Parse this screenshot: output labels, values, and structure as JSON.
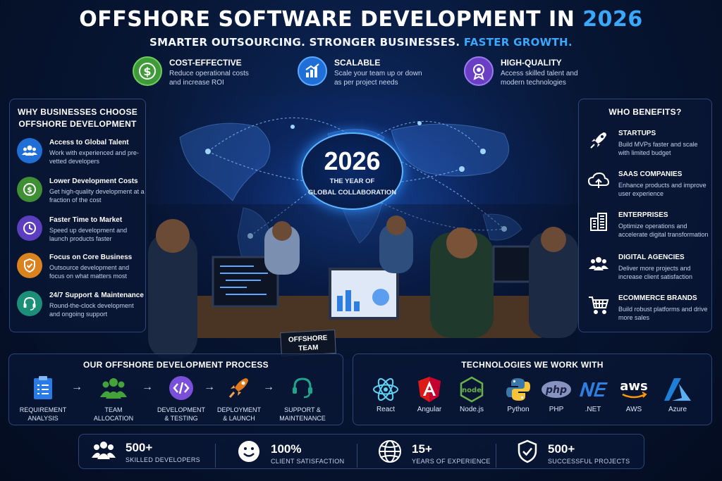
{
  "header": {
    "title_main": "OFFSHORE SOFTWARE DEVELOPMENT IN ",
    "title_year": "2026",
    "subtitle_main": "SMARTER OUTSOURCING. STRONGER BUSINESSES. ",
    "subtitle_highlight": "FASTER GROWTH."
  },
  "features": [
    {
      "title": "COST-EFFECTIVE",
      "desc": "Reduce operational costs and increase ROI",
      "icon": "dollar-icon",
      "color": "#3f9a3a"
    },
    {
      "title": "SCALABLE",
      "desc": "Scale your team up or down as per project needs",
      "icon": "growth-chart-icon",
      "color": "#1f6fd6"
    },
    {
      "title": "HIGH-QUALITY",
      "desc": "Access skilled talent and modern technologies",
      "icon": "award-badge-icon",
      "color": "#6a3fc4"
    }
  ],
  "hub": {
    "year": "2026",
    "line1": "THE YEAR OF",
    "line2": "GLOBAL COLLABORATION"
  },
  "why": {
    "title_line1": "WHY BUSINESSES CHOOSE",
    "title_line2": "OFFSHORE DEVELOPMENT",
    "items": [
      {
        "title": "Access to Global Talent",
        "desc": "Work with experienced and pre-vetted developers",
        "icon": "team-icon",
        "color": "#1f6fd6"
      },
      {
        "title": "Lower Development Costs",
        "desc": "Get high-quality development at a fraction of the cost",
        "icon": "cost-down-icon",
        "color": "#3f8f34"
      },
      {
        "title": "Faster Time to Market",
        "desc": "Speed up development and launch products faster",
        "icon": "clock-icon",
        "color": "#5b3fc0"
      },
      {
        "title": "Focus on Core Business",
        "desc": "Outsource development and focus on what matters most",
        "icon": "shield-check-icon",
        "color": "#d9821e"
      },
      {
        "title": "24/7 Support & Maintenance",
        "desc": "Round-the-clock development and ongoing support",
        "icon": "headset-icon",
        "color": "#1c8f78"
      }
    ]
  },
  "benefits": {
    "title": "WHO BENEFITS?",
    "items": [
      {
        "title": "STARTUPS",
        "desc": "Build MVPs faster and scale with limited budget",
        "icon": "rocket-icon"
      },
      {
        "title": "SAAS COMPANIES",
        "desc": "Enhance products and improve user experience",
        "icon": "cloud-icon"
      },
      {
        "title": "ENTERPRISES",
        "desc": "Optimize operations and accelerate digital transformation",
        "icon": "building-icon"
      },
      {
        "title": "DIGITAL AGENCIES",
        "desc": "Deliver more projects and increase client satisfaction",
        "icon": "people-group-icon"
      },
      {
        "title": "ECOMMERCE BRANDS",
        "desc": "Build robust platforms and drive more sales",
        "icon": "cart-icon"
      }
    ]
  },
  "badge": {
    "line1": "OFFSHORE",
    "line2": "TEAM"
  },
  "process": {
    "title": "OUR OFFSHORE DEVELOPMENT PROCESS",
    "steps": [
      {
        "line1": "REQUIREMENT",
        "line2": "ANALYSIS",
        "icon": "clipboard-icon",
        "color": "#2a7be6"
      },
      {
        "line1": "TEAM",
        "line2": "ALLOCATION",
        "icon": "team-allocation-icon",
        "color": "#43a33a"
      },
      {
        "line1": "DEVELOPMENT",
        "line2": "& TESTING",
        "icon": "code-icon",
        "color": "#7a4fd9"
      },
      {
        "line1": "DEPLOYMENT",
        "line2": "& LAUNCH",
        "icon": "rocket-launch-icon",
        "color": "#e07a1d"
      },
      {
        "line1": "SUPPORT &",
        "line2": "MAINTENANCE",
        "icon": "headset-support-icon",
        "color": "#1fa58c"
      }
    ]
  },
  "technologies": {
    "title": "TECHNOLOGIES WE WORK WITH",
    "items": [
      {
        "name": "React",
        "icon": "react-icon",
        "color": "#5ed3f3"
      },
      {
        "name": "Angular",
        "icon": "angular-icon",
        "color": "#dd1b16"
      },
      {
        "name": "Node.js",
        "icon": "nodejs-icon",
        "color": "#6ab04c"
      },
      {
        "name": "Python",
        "icon": "python-icon",
        "color": "#3b77a8"
      },
      {
        "name": "PHP",
        "icon": "php-icon",
        "color": "#8892bf"
      },
      {
        "name": ".NET",
        "icon": "dotnet-icon",
        "color": "#2f7fe0"
      },
      {
        "name": "AWS",
        "icon": "aws-icon",
        "color": "#ff9900"
      },
      {
        "name": "Azure",
        "icon": "azure-icon",
        "color": "#1e7fd8"
      }
    ]
  },
  "stats": [
    {
      "number": "500+",
      "label": "SKILLED DEVELOPERS",
      "icon": "developers-icon"
    },
    {
      "number": "100%",
      "label": "CLIENT SATISFACTION",
      "icon": "smiley-icon"
    },
    {
      "number": "15+",
      "label": "YEARS OF EXPERIENCE",
      "icon": "globe-icon"
    },
    {
      "number": "500+",
      "label": "SUCCESSFUL PROJECTS",
      "icon": "shield-check-stat-icon"
    }
  ]
}
